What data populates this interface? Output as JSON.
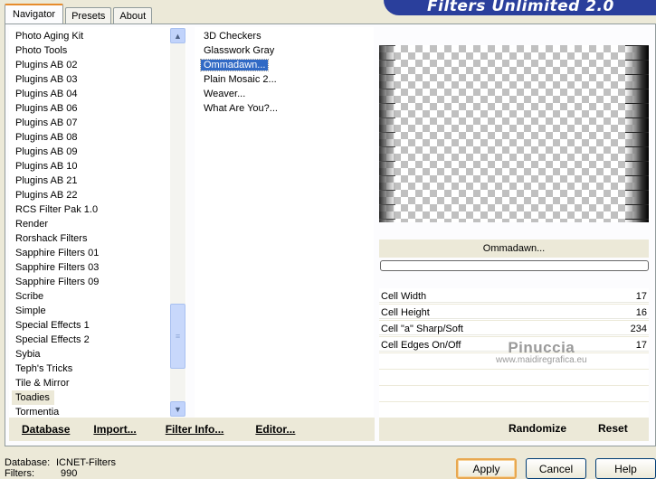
{
  "app_title": "Filters Unlimited 2.0",
  "tabs": [
    "Navigator",
    "Presets",
    "About"
  ],
  "categories": [
    "Photo Aging Kit",
    "Photo Tools",
    "Plugins AB 02",
    "Plugins AB 03",
    "Plugins AB 04",
    "Plugins AB 06",
    "Plugins AB 07",
    "Plugins AB 08",
    "Plugins AB 09",
    "Plugins AB 10",
    "Plugins AB 21",
    "Plugins AB 22",
    "RCS Filter Pak 1.0",
    "Render",
    "Rorshack Filters",
    "Sapphire Filters 01",
    "Sapphire Filters 03",
    "Sapphire Filters 09",
    "Scribe",
    "Simple",
    "Special Effects 1",
    "Special Effects 2",
    "Sybia",
    "Teph's Tricks",
    "Tile & Mirror",
    "Toadies",
    "Tormentia"
  ],
  "filters": [
    "3D Checkers",
    "Glasswork Gray",
    "Ommadawn...",
    "Plain Mosaic 2...",
    "Weaver...",
    "What Are You?..."
  ],
  "selected_filter": "Ommadawn...",
  "preview_label": "Ommadawn...",
  "params": [
    {
      "name": "Cell Width",
      "value": "17"
    },
    {
      "name": "Cell Height",
      "value": "16"
    },
    {
      "name": "Cell \"a\" Sharp/Soft",
      "value": "234"
    },
    {
      "name": "Cell Edges On/Off",
      "value": "17"
    }
  ],
  "watermark": {
    "line1": "Pinuccia",
    "line2": "www.maidiregrafica.eu"
  },
  "left_buttons": [
    "Database",
    "Import...",
    "Filter Info...",
    "Editor..."
  ],
  "right_buttons": [
    "Randomize",
    "Reset"
  ],
  "status": {
    "database_label": "Database:",
    "database_value": "ICNET-Filters",
    "filters_label": "Filters:",
    "filters_value": "990"
  },
  "dialog_buttons": {
    "apply": "Apply",
    "cancel": "Cancel",
    "help": "Help"
  }
}
